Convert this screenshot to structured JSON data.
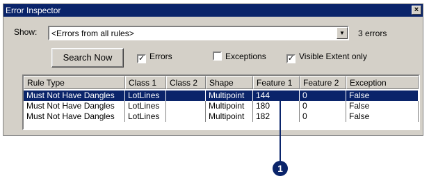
{
  "window": {
    "title": "Error Inspector",
    "close_glyph": "×"
  },
  "show": {
    "label": "Show:",
    "value": "<Errors from all rules>"
  },
  "error_count": "3 errors",
  "search_button": "Search Now",
  "checkboxes": [
    {
      "label": "Errors",
      "checked": true
    },
    {
      "label": "Exceptions",
      "checked": false
    },
    {
      "label": "Visible Extent only",
      "checked": true
    }
  ],
  "table": {
    "columns": [
      "Rule Type",
      "Class 1",
      "Class 2",
      "Shape",
      "Feature 1",
      "Feature 2",
      "Exception"
    ],
    "rows": [
      {
        "rule_type": "Must Not Have Dangles",
        "class1": "LotLines",
        "class2": "",
        "shape": "Multipoint",
        "feature1": "144",
        "feature2": "0",
        "exception": "False",
        "selected": true
      },
      {
        "rule_type": "Must Not Have Dangles",
        "class1": "LotLines",
        "class2": "",
        "shape": "Multipoint",
        "feature1": "180",
        "feature2": "0",
        "exception": "False",
        "selected": false
      },
      {
        "rule_type": "Must Not Have Dangles",
        "class1": "LotLines",
        "class2": "",
        "shape": "Multipoint",
        "feature1": "182",
        "feature2": "0",
        "exception": "False",
        "selected": false
      }
    ]
  },
  "callout": {
    "number": "1"
  },
  "colors": {
    "selection": "#0a246a",
    "face": "#d4d0c8"
  },
  "icons": {
    "close": "close-icon",
    "dropdown": "chevron-down-icon",
    "check": "checkmark-icon"
  }
}
